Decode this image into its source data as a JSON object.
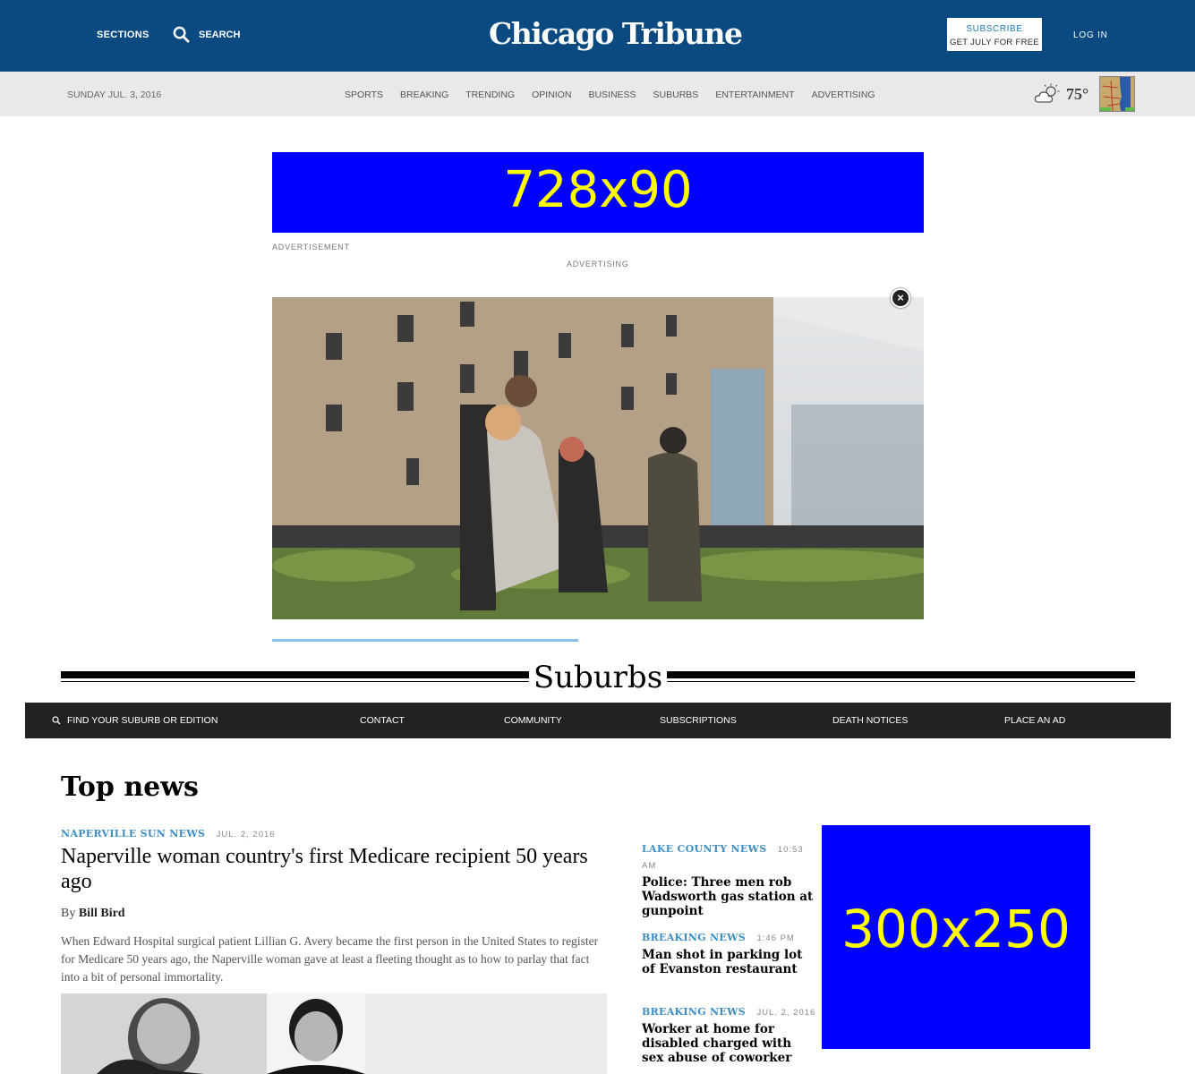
{
  "header": {
    "sections_label": "SECTIONS",
    "search_label": "SEARCH",
    "logo_text": "Chicago Tribune",
    "subscribe_line1": "SUBSCRIBE",
    "subscribe_line2": "GET JULY FOR FREE",
    "login_label": "LOG IN"
  },
  "navbar": {
    "date": "SUNDAY JUL. 3, 2016",
    "items": [
      "SPORTS",
      "BREAKING",
      "TRENDING",
      "OPINION",
      "BUSINESS",
      "SUBURBS",
      "ENTERTAINMENT",
      "ADVERTISING"
    ],
    "weather_icon": "partly-cloudy-icon",
    "temperature": "75°"
  },
  "ads": {
    "leaderboard_text": "728x90",
    "advertisement_label": "ADVERTISEMENT",
    "advertising_label": "ADVERTISING",
    "rectangle_text": "300x250"
  },
  "video": {
    "close_glyph": "×",
    "progress_fraction": 0.47
  },
  "section": {
    "title": "Suburbs",
    "find_label": "FIND YOUR SUBURB OR EDITION",
    "links": [
      "CONTACT",
      "COMMUNITY",
      "SUBSCRIPTIONS",
      "DEATH NOTICES",
      "PLACE AN AD"
    ]
  },
  "top_news": {
    "heading": "Top news",
    "lead": {
      "kicker": "NAPERVILLE SUN NEWS",
      "date": "JUL. 2, 2016",
      "headline": "Naperville woman country's first Medicare recipient 50 years ago",
      "by_prefix": "By",
      "author": "Bill Bird",
      "summary": "When Edward Hospital surgical patient Lillian G. Avery became the first person in the United States to register for Medicare 50 years ago, the Naperville woman gave at least a fleeting thought as to how to parlay that fact into a bit of personal immortality."
    },
    "side": [
      {
        "kicker": "LAKE COUNTY NEWS",
        "date": "10:53 AM",
        "headline": "Police: Three men rob Wadsworth gas station at gunpoint"
      },
      {
        "kicker": "BREAKING NEWS",
        "date": "1:46 PM",
        "headline": "Man shot in parking lot of Evanston restaurant"
      },
      {
        "kicker": "BREAKING NEWS",
        "date": "JUL. 2, 2016",
        "headline": "Worker at home for disabled charged with sex abuse of coworker"
      }
    ]
  }
}
